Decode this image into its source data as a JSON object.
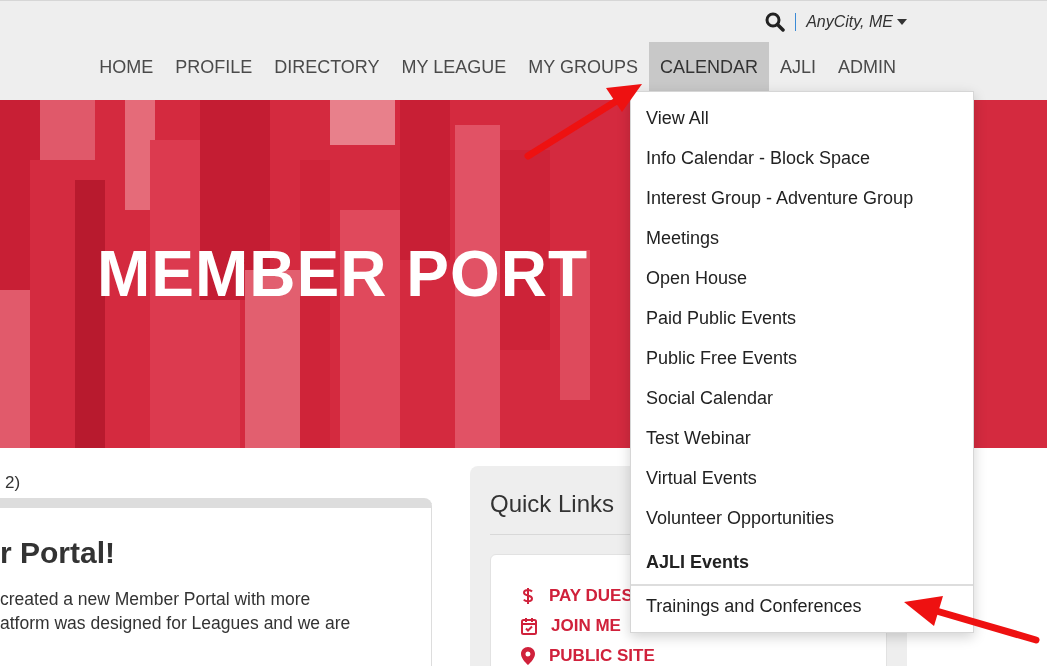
{
  "header": {
    "location": "AnyCity, ME",
    "nav": [
      {
        "label": "HOME",
        "selected": false
      },
      {
        "label": "PROFILE",
        "selected": false
      },
      {
        "label": "DIRECTORY",
        "selected": false
      },
      {
        "label": "MY LEAGUE",
        "selected": false
      },
      {
        "label": "MY GROUPS",
        "selected": false
      },
      {
        "label": "CALENDAR",
        "selected": true
      },
      {
        "label": "AJLI",
        "selected": false
      },
      {
        "label": "ADMIN",
        "selected": false
      }
    ]
  },
  "banner": {
    "title": "MEMBER PORT"
  },
  "main": {
    "pager": "2)",
    "card": {
      "heading": "r Portal!",
      "lines": [
        "created a new Member Portal with more",
        "atform was designed for Leagues and we are"
      ]
    }
  },
  "quick_links": {
    "title": "Quick Links",
    "links": [
      {
        "label": "PAY DUES",
        "kind": "dues"
      },
      {
        "label": "JOIN ME",
        "kind": "calendar"
      },
      {
        "label": "PUBLIC SITE",
        "kind": "location"
      }
    ]
  },
  "dropdown": {
    "items": [
      {
        "label": "View All",
        "kind": "link"
      },
      {
        "label": "Info Calendar - Block Space",
        "kind": "link"
      },
      {
        "label": "Interest Group - Adventure Group",
        "kind": "link"
      },
      {
        "label": "Meetings",
        "kind": "link"
      },
      {
        "label": "Open House",
        "kind": "link"
      },
      {
        "label": "Paid Public Events",
        "kind": "link"
      },
      {
        "label": "Public Free Events",
        "kind": "link"
      },
      {
        "label": "Social Calendar",
        "kind": "link"
      },
      {
        "label": "Test Webinar",
        "kind": "link"
      },
      {
        "label": "Virtual Events",
        "kind": "link"
      },
      {
        "label": "Volunteer Opportunities",
        "kind": "link"
      },
      {
        "label": "AJLI Events",
        "kind": "heading"
      },
      {
        "label": "Trainings and Conferences",
        "kind": "link"
      }
    ]
  }
}
